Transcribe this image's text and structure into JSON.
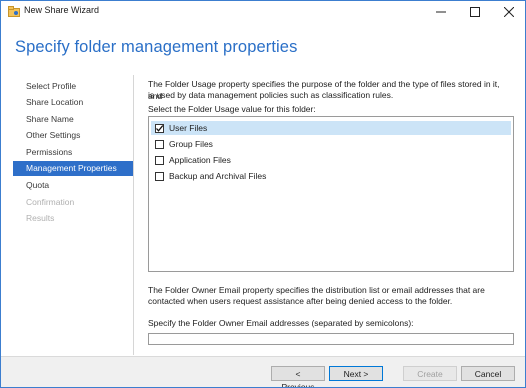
{
  "window": {
    "title": "New Share Wizard"
  },
  "header": {
    "title": "Specify folder management properties"
  },
  "sidebar": {
    "items": [
      {
        "label": "Select Profile",
        "state": "normal"
      },
      {
        "label": "Share Location",
        "state": "normal"
      },
      {
        "label": "Share Name",
        "state": "normal"
      },
      {
        "label": "Other Settings",
        "state": "normal"
      },
      {
        "label": "Permissions",
        "state": "normal"
      },
      {
        "label": "Management Properties",
        "state": "active"
      },
      {
        "label": "Quota",
        "state": "normal"
      },
      {
        "label": "Confirmation",
        "state": "disabled"
      },
      {
        "label": "Results",
        "state": "disabled"
      }
    ]
  },
  "main": {
    "usage_description_line1": "The Folder Usage property specifies the purpose of the folder and the type of files stored in it, and",
    "usage_description_line2": "is used by data management policies such as classification rules.",
    "usage_prompt": "Select the Folder Usage value for this folder:",
    "usage_options": [
      {
        "label": "User Files",
        "checked": true
      },
      {
        "label": "Group Files",
        "checked": false
      },
      {
        "label": "Application Files",
        "checked": false
      },
      {
        "label": "Backup and Archival Files",
        "checked": false
      }
    ],
    "owner_description_line1": "The Folder Owner Email property specifies the distribution list or email addresses that are",
    "owner_description_line2": "contacted when users request assistance after being denied access to the folder.",
    "owner_email_label": "Specify the Folder Owner Email addresses (separated by semicolons):",
    "owner_email_value": ""
  },
  "footer": {
    "previous_label": "< Previous",
    "next_label": "Next >",
    "create_label": "Create",
    "cancel_label": "Cancel"
  },
  "colors": {
    "accent": "#2e6fc9",
    "title_blue": "#2a6fc7",
    "selection": "#cce4f7"
  },
  "icons": {
    "app": "share-wizard-icon",
    "minimize": "minimize-icon",
    "maximize": "maximize-icon",
    "close": "close-icon",
    "check": "checkmark-icon"
  }
}
